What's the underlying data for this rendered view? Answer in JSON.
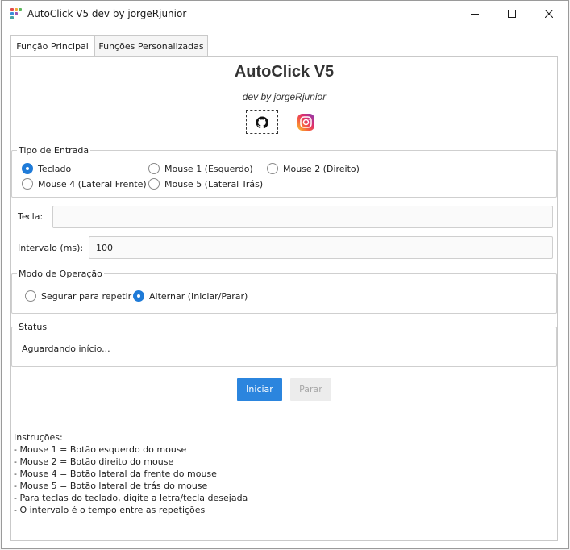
{
  "window": {
    "title": "AutoClick V5 dev by jorgeRjunior"
  },
  "tabs": [
    "Função Principal",
    "Funções Personalizadas"
  ],
  "header": {
    "title": "AutoClick V5",
    "subtitle": "dev by jorgeRjunior"
  },
  "input_type": {
    "legend": "Tipo de Entrada",
    "options": [
      "Teclado",
      "Mouse 1 (Esquerdo)",
      "Mouse 2 (Direito)",
      "Mouse 4 (Lateral Frente)",
      "Mouse 5 (Lateral Trás)"
    ],
    "selected": "Teclado"
  },
  "key": {
    "label": "Tecla:",
    "value": ""
  },
  "interval": {
    "label": "Intervalo (ms):",
    "value": "100"
  },
  "mode": {
    "legend": "Modo de Operação",
    "options": [
      "Segurar para repetir",
      "Alternar (Iniciar/Parar)"
    ],
    "selected": "Alternar (Iniciar/Parar)"
  },
  "status": {
    "legend": "Status",
    "text": "Aguardando início..."
  },
  "buttons": {
    "start": "Iniciar",
    "stop": "Parar"
  },
  "instructions": {
    "title": "Instruções:",
    "lines": [
      "- Mouse 1 = Botão esquerdo do mouse",
      "- Mouse 2 = Botão direito do mouse",
      "- Mouse 4 = Botão lateral da frente do mouse",
      "- Mouse 5 = Botão lateral de trás do mouse",
      "- Para teclas do teclado, digite a letra/tecla desejada",
      "- O intervalo é o tempo entre as repetições"
    ]
  },
  "colors": {
    "accent": "#2b85de",
    "radio_on": "#1f7bd8"
  }
}
